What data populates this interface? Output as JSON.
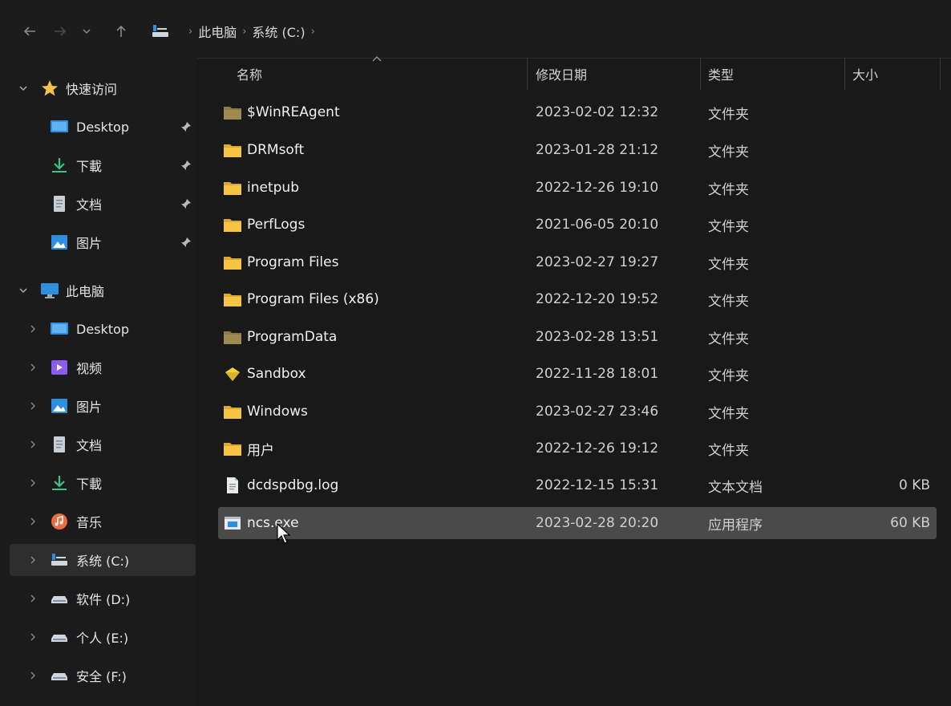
{
  "breadcrumb": {
    "items": [
      "此电脑",
      "系统 (C:)"
    ]
  },
  "sidebar": {
    "quick_access": {
      "label": "快速访问",
      "items": [
        {
          "label": "Desktop",
          "icon": "desktop-icon"
        },
        {
          "label": "下載",
          "icon": "download-icon"
        },
        {
          "label": "文档",
          "icon": "document-icon"
        },
        {
          "label": "图片",
          "icon": "pictures-icon"
        }
      ]
    },
    "this_pc": {
      "label": "此电脑",
      "items": [
        {
          "label": "Desktop",
          "icon": "desktop-icon"
        },
        {
          "label": "视频",
          "icon": "video-icon"
        },
        {
          "label": "图片",
          "icon": "pictures-icon"
        },
        {
          "label": "文档",
          "icon": "document-icon"
        },
        {
          "label": "下載",
          "icon": "download-icon"
        },
        {
          "label": "音乐",
          "icon": "music-icon"
        },
        {
          "label": "系统 (C:)",
          "icon": "system-drive-icon"
        },
        {
          "label": "软件 (D:)",
          "icon": "drive-icon"
        },
        {
          "label": "个人 (E:)",
          "icon": "drive-icon"
        },
        {
          "label": "安全 (F:)",
          "icon": "drive-icon"
        }
      ]
    }
  },
  "columns": {
    "name": "名称",
    "date": "修改日期",
    "type": "类型",
    "size": "大小"
  },
  "files": [
    {
      "name": "$WinREAgent",
      "date": "2023-02-02 12:32",
      "type": "文件夹",
      "size": "",
      "icon": "folder-dim-icon"
    },
    {
      "name": "DRMsoft",
      "date": "2023-01-28 21:12",
      "type": "文件夹",
      "size": "",
      "icon": "folder-icon"
    },
    {
      "name": "inetpub",
      "date": "2022-12-26 19:10",
      "type": "文件夹",
      "size": "",
      "icon": "folder-icon"
    },
    {
      "name": "PerfLogs",
      "date": "2021-06-05 20:10",
      "type": "文件夹",
      "size": "",
      "icon": "folder-icon"
    },
    {
      "name": "Program Files",
      "date": "2023-02-27 19:27",
      "type": "文件夹",
      "size": "",
      "icon": "folder-icon"
    },
    {
      "name": "Program Files (x86)",
      "date": "2022-12-20 19:52",
      "type": "文件夹",
      "size": "",
      "icon": "folder-icon"
    },
    {
      "name": "ProgramData",
      "date": "2023-02-28 13:51",
      "type": "文件夹",
      "size": "",
      "icon": "folder-dim-icon"
    },
    {
      "name": "Sandbox",
      "date": "2022-11-28 18:01",
      "type": "文件夹",
      "size": "",
      "icon": "sandbox-icon"
    },
    {
      "name": "Windows",
      "date": "2023-02-27 23:46",
      "type": "文件夹",
      "size": "",
      "icon": "folder-icon"
    },
    {
      "name": "用户",
      "date": "2022-12-26 19:12",
      "type": "文件夹",
      "size": "",
      "icon": "folder-icon"
    },
    {
      "name": "dcdspdbg.log",
      "date": "2022-12-15 15:31",
      "type": "文本文档",
      "size": "0 KB",
      "icon": "text-file-icon"
    },
    {
      "name": "ncs.exe",
      "date": "2023-02-28 20:20",
      "type": "应用程序",
      "size": "60 KB",
      "icon": "exe-file-icon",
      "selected": true
    }
  ],
  "colors": {
    "background": "#191919",
    "selected_row": "#4a4a4a",
    "folder_yellow": "#f3c443",
    "accent_blue": "#2e8fe0"
  }
}
